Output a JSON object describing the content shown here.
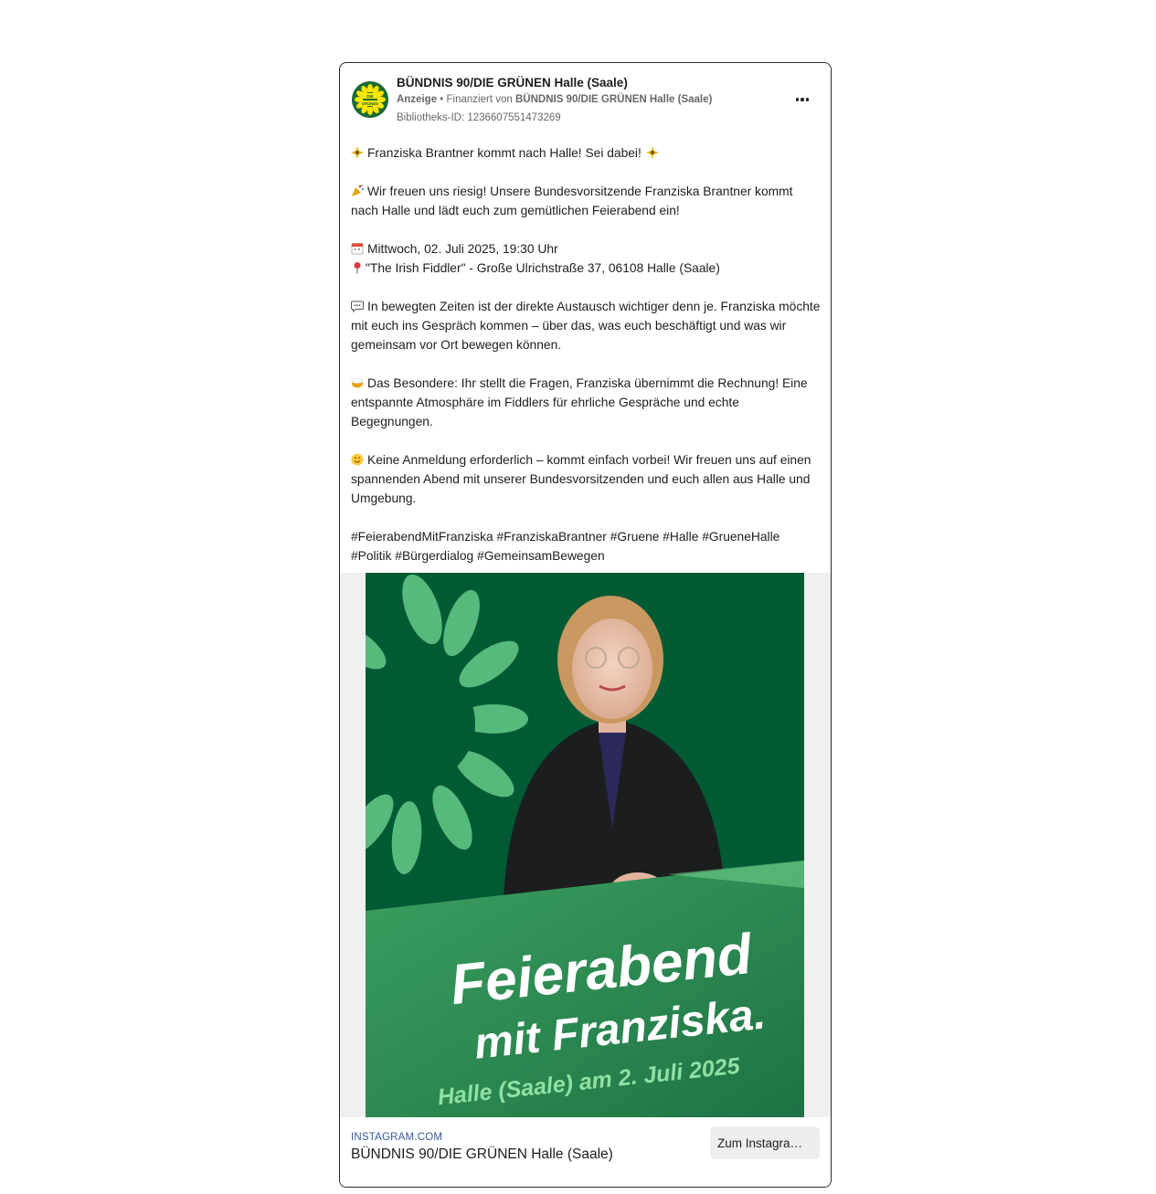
{
  "colors": {
    "brand_green_dark": "#005a34",
    "brand_green_mid": "#2f8a52",
    "brand_green_light": "#6fce8a",
    "link_blue": "#385898",
    "text_secondary": "#65676b"
  },
  "ad": {
    "page_name": "BÜNDNIS 90/DIE GRÜNEN Halle (Saale)",
    "sponsored_label": "Anzeige",
    "funded_by_prefix": "Finanziert von",
    "funded_by_name": "BÜNDNIS 90/DIE GRÜNEN Halle (Saale)",
    "library_id": "Bibliotheks-ID: 1236607551473269",
    "avatar_text_top": "DIE",
    "avatar_text_bottom": "GRÜNEN",
    "more_icon": "more-horizontal-icon"
  },
  "body": {
    "headline": "Franziska Brantner kommt nach Halle! Sei dabei!",
    "intro": "Wir freuen uns riesig! Unsere Bundesvorsitzende Franziska Brantner kommt nach Halle und lädt euch zum gemütlichen Feierabend ein!",
    "date_line": "Mittwoch, 02. Juli 2025, 19:30 Uhr",
    "location_line": "\"The Irish Fiddler\" - Große Ulrichstraße 37, 06108 Halle (Saale)",
    "exchange": "In bewegten Zeiten ist der direkte Austausch wichtiger denn je. Franziska möchte mit euch ins Gespräch kommen – über das, was euch beschäftigt und was wir gemeinsam vor Ort bewegen können.",
    "special": "Das Besondere: Ihr stellt die Fragen, Franziska übernimmt die Rechnung! Eine entspannte Atmosphäre im Fiddlers für ehrliche Gespräche und echte Begegnungen.",
    "no_signup": "Keine Anmeldung erforderlich – kommt einfach vorbei! Wir freuen uns auf einen spannenden Abend mit unserer Bundesvorsitzenden und euch allen aus Halle und Umgebung.",
    "hashtags": "#FeierabendMitFranziska #FranziskaBrantner #Gruene #Halle #GrueneHalle #Politik #Bürgerdialog #GemeinsamBewegen"
  },
  "creative": {
    "line1": "Feierabend",
    "line2": "mit Franziska.",
    "line3": "Halle (Saale) am 2. Juli 2025"
  },
  "link": {
    "domain": "INSTAGRAM.COM",
    "title": "BÜNDNIS 90/DIE GRÜNEN Halle (Saale)",
    "cta_label": "Zum Instagram-Profil"
  }
}
